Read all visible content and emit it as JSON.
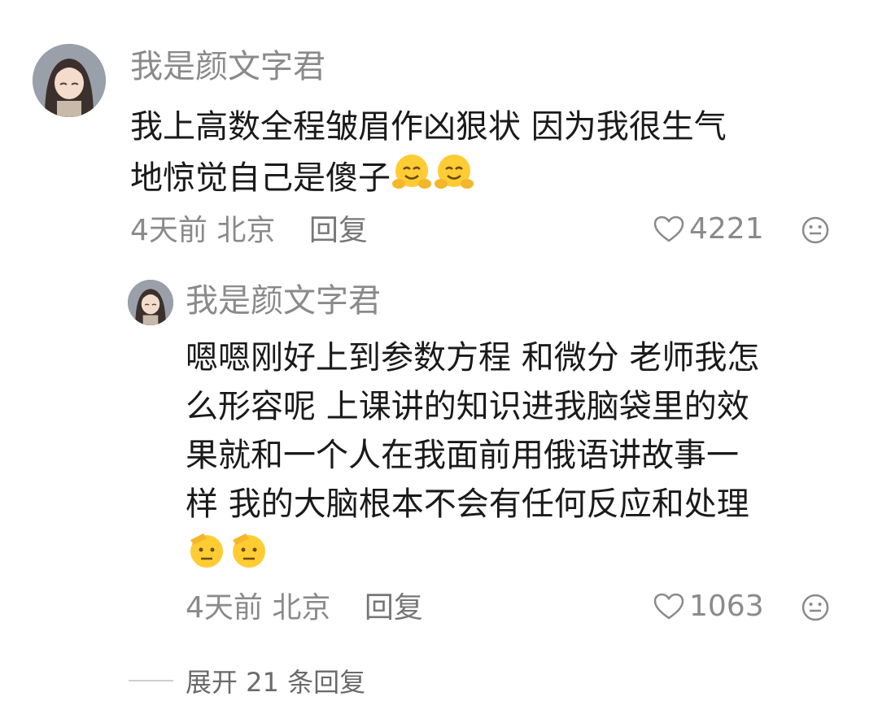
{
  "comments": [
    {
      "username": "我是颜文字君",
      "text_lines": [
        "我上高数全程皱眉作凶狠状 因为我很生气",
        "地惊觉自己是傻子"
      ],
      "emojis": [
        "hugging-face",
        "hugging-face"
      ],
      "time": "4天前",
      "location": "北京",
      "reply_label": "回复",
      "likes": "4221"
    }
  ],
  "reply": {
    "username": "我是颜文字君",
    "text_lines": [
      "嗯嗯刚好上到参数方程 和微分 老师我怎",
      "么形容呢 上课讲的知识进我脑袋里的效",
      "果就和一个人在我面前用俄语讲故事一",
      "样 我的大脑根本不会有任何反应和处理"
    ],
    "emojis": [
      "saluting-face",
      "saluting-face"
    ],
    "time": "4天前",
    "location": "北京",
    "reply_label": "回复",
    "likes": "1063"
  },
  "expand_label": "展开 21 条回复"
}
